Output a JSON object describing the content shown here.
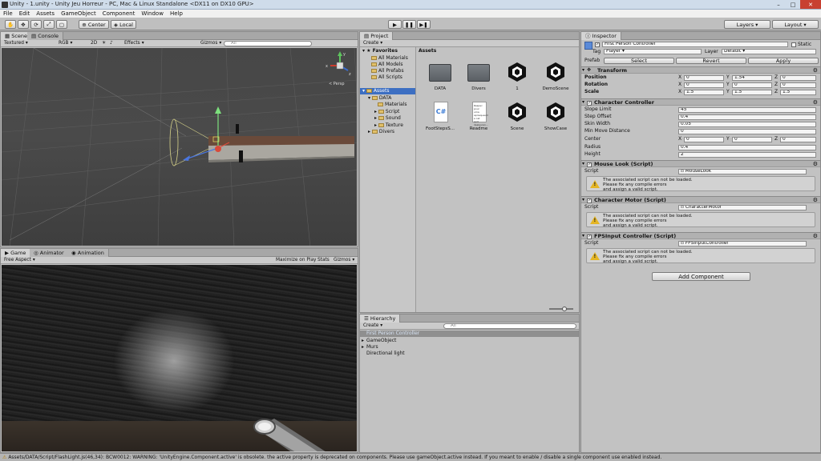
{
  "window": {
    "title": "Unity - 1.unity - Unity Jeu Horreur - PC, Mac & Linux Standalone <DX11 on DX10 GPU>",
    "controls": [
      "–",
      "□",
      "✕"
    ]
  },
  "menu": [
    "File",
    "Edit",
    "Assets",
    "GameObject",
    "Component",
    "Window",
    "Help"
  ],
  "toolbar": {
    "tools": [
      "✋",
      "✥",
      "⟳",
      "⤢",
      "▢"
    ],
    "pivot": "Center",
    "space": "Local",
    "play": "▶",
    "pause": "❚❚",
    "step": "▶❚",
    "layers": "Layers",
    "layout": "Layout"
  },
  "scene": {
    "tabs": [
      "Scene",
      "Console"
    ],
    "shading": "Textured",
    "render": "RGB",
    "mode2d": "2D",
    "effects": "Effects",
    "gizmos": "Gizmos",
    "search_placeholder": "All",
    "persp": "< Persp",
    "axis": {
      "x": "x",
      "y": "y",
      "z": "z"
    }
  },
  "game": {
    "tabs": [
      "Game",
      "Animator",
      "Animation"
    ],
    "aspect": "Free Aspect",
    "maximize": "Maximize on Play",
    "stats": "Stats",
    "gizmos": "Gizmos"
  },
  "project": {
    "tab": "Project",
    "create": "Create",
    "favorites": {
      "label": "Favorites",
      "items": [
        "All Materials",
        "All Models",
        "All Prefabs",
        "All Scripts"
      ]
    },
    "assets_label": "Assets",
    "tree": [
      "DATA",
      "Materials",
      "Script",
      "Sound",
      "Texture",
      "Divers"
    ],
    "breadcrumb": "Assets",
    "assets": [
      {
        "name": "DATA",
        "kind": "folder"
      },
      {
        "name": "Divers",
        "kind": "folder"
      },
      {
        "name": "1",
        "kind": "unity"
      },
      {
        "name": "DemoScene",
        "kind": "unity"
      },
      {
        "name": "FootStepsS...",
        "kind": "cs"
      },
      {
        "name": "Readme",
        "kind": "doc"
      },
      {
        "name": "Scene",
        "kind": "unity"
      },
      {
        "name": "ShowCase",
        "kind": "unity"
      }
    ],
    "cs_label": "C#",
    "readme_preview": "Respec pour uma apriequeum e cet qud desleuran..."
  },
  "hierarchy": {
    "tab": "Hierarchy",
    "create": "Create",
    "search_placeholder": "All",
    "items": [
      "First Person Controller",
      "GameObject",
      "Murs",
      "Directional light"
    ]
  },
  "inspector": {
    "tab": "Inspector",
    "object_name": "First Person Controller",
    "static_label": "Static",
    "tag_label": "Tag",
    "tag_value": "Player",
    "layer_label": "Layer",
    "layer_value": "Default",
    "prefab_label": "Prefab",
    "prefab_select": "Select",
    "prefab_revert": "Revert",
    "prefab_apply": "Apply",
    "transform": {
      "title": "Transform",
      "rows": [
        {
          "label": "Position",
          "x": "0",
          "y": "1.54",
          "z": "0"
        },
        {
          "label": "Rotation",
          "x": "0",
          "y": "0",
          "z": "0"
        },
        {
          "label": "Scale",
          "x": "1.5",
          "y": "1.5",
          "z": "1.5"
        }
      ],
      "axis": [
        "X",
        "Y",
        "Z"
      ]
    },
    "character_controller": {
      "title": "Character Controller",
      "slope_limit_label": "Slope Limit",
      "slope_limit": "45",
      "step_offset_label": "Step Offset",
      "step_offset": "0.4",
      "skin_width_label": "Skin Width",
      "skin_width": "0.05",
      "min_move_label": "Min Move Distance",
      "min_move": "0",
      "center_label": "Center",
      "center": {
        "x": "0",
        "y": "0",
        "z": "0"
      },
      "radius_label": "Radius",
      "radius": "0.4",
      "height_label": "Height",
      "height": "2"
    },
    "scripts": [
      {
        "title": "Mouse Look (Script)",
        "script": "MouseLook"
      },
      {
        "title": "Character Motor (Script)",
        "script": "CharacterMotor"
      },
      {
        "title": "FPSInput Controller (Script)",
        "script": "FPSInputController"
      }
    ],
    "script_label": "Script",
    "warning_lines": [
      "The associated script can not be loaded.",
      "Please fix any compile errors",
      "and assign a valid script."
    ],
    "add_component": "Add Component"
  },
  "status": "Assets/DATA/Script/FlashLight.js(46,34): BCW0012: WARNING: 'UnityEngine.Component.active' is obsolete. the active property is deprecated on components. Please use gameObject.active instead. If you meant to enable / disable a single component use enabled instead."
}
